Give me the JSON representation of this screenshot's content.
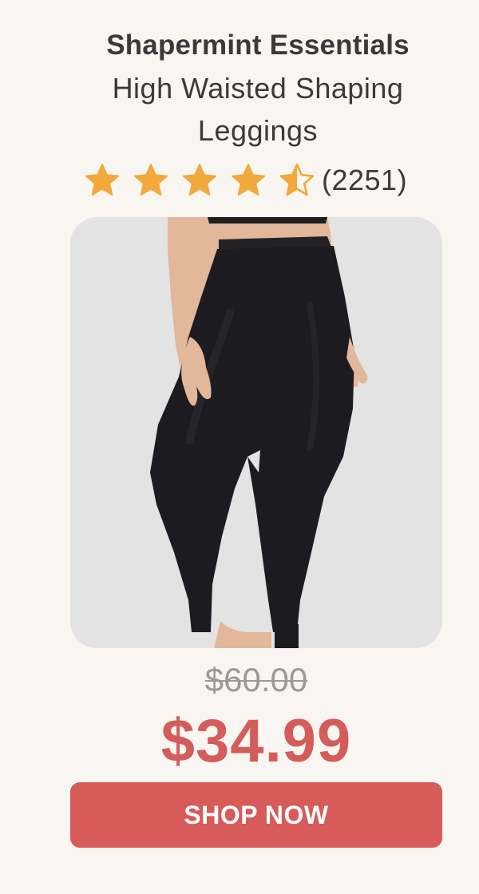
{
  "product": {
    "brand": "Shapermint Essentials",
    "name": "High Waisted Shaping Leggings"
  },
  "rating": {
    "value": 4.5,
    "max": 5,
    "review_count": "(2251)",
    "star_color": "#f2a83a"
  },
  "image": {
    "icon": "product-photo-leggings"
  },
  "pricing": {
    "original_price": "$60.00",
    "sale_price": "$34.99",
    "sale_color": "#d45c5b"
  },
  "cta": {
    "label": "SHOP NOW",
    "color": "#d65b59"
  }
}
